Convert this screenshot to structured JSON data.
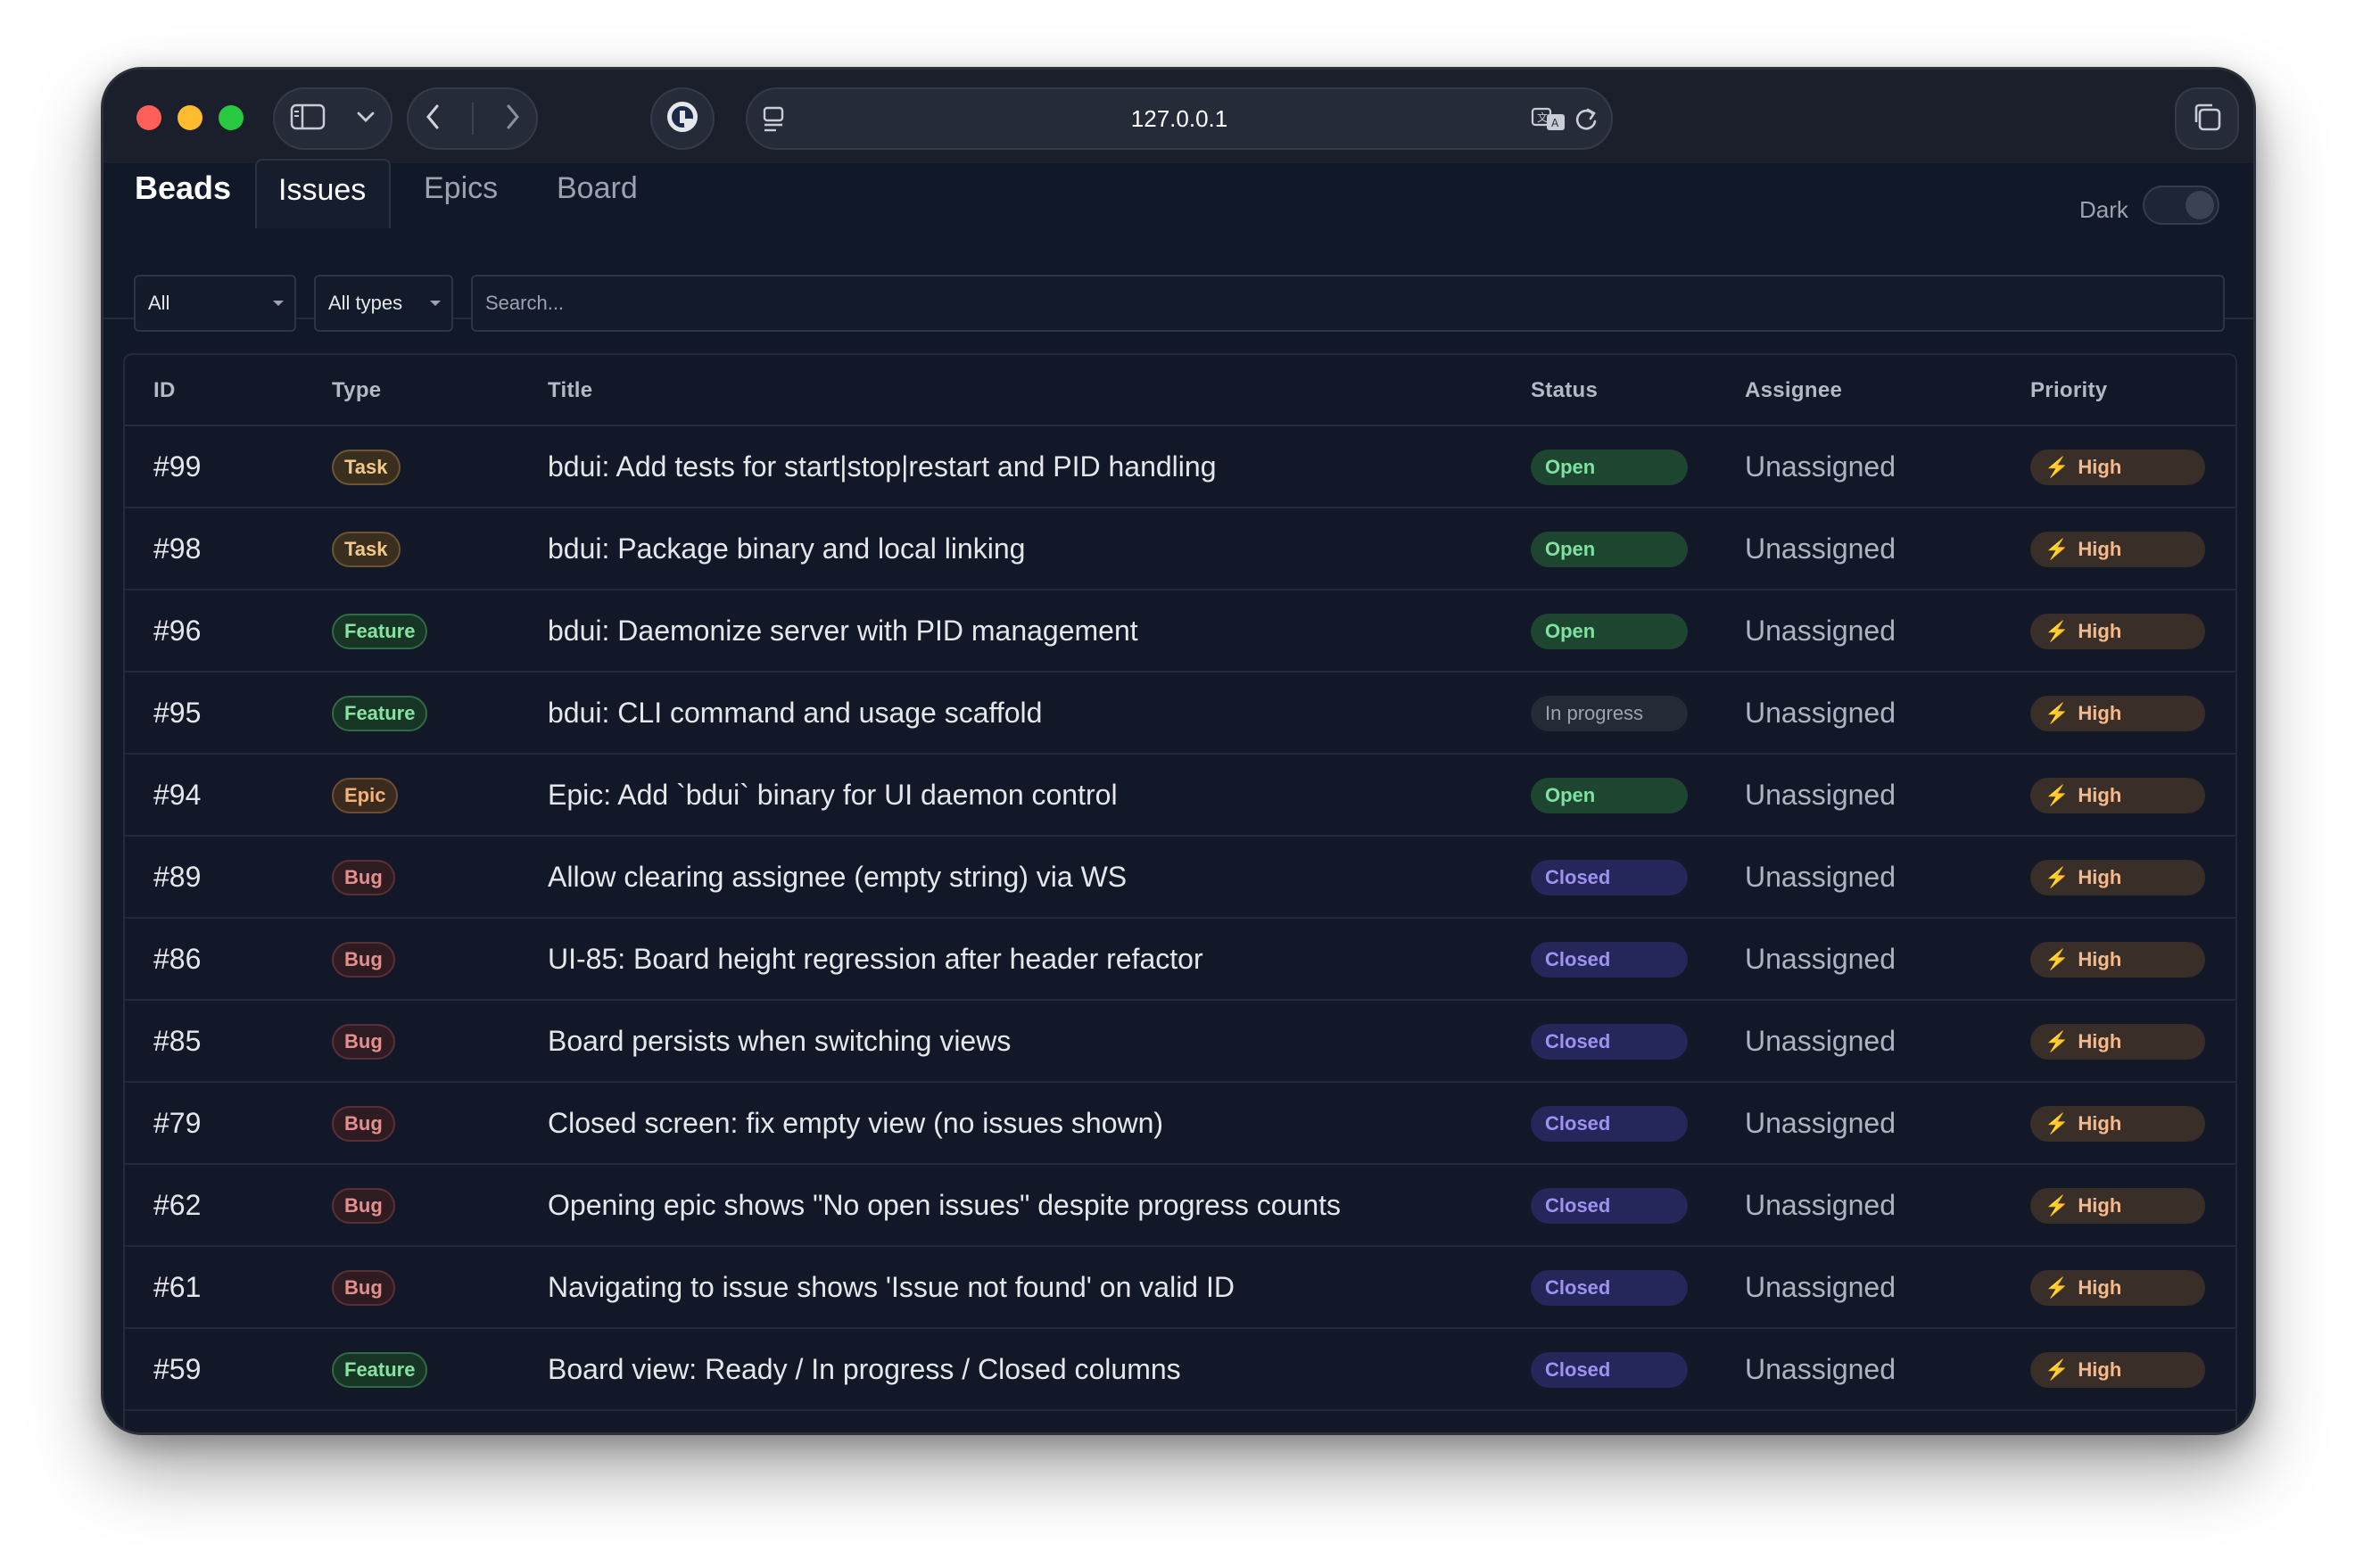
{
  "browser": {
    "address": "127.0.0.1"
  },
  "app": {
    "brand": "Beads",
    "tabs": [
      {
        "label": "Issues"
      },
      {
        "label": "Epics"
      },
      {
        "label": "Board"
      }
    ],
    "dark_label": "Dark"
  },
  "filters": {
    "status_value": "All",
    "type_value": "All types",
    "search_placeholder": "Search..."
  },
  "table": {
    "headers": {
      "id": "ID",
      "type": "Type",
      "title": "Title",
      "status": "Status",
      "assignee": "Assignee",
      "priority": "Priority"
    },
    "rows": [
      {
        "id": "#99",
        "type": "Task",
        "title": "bdui: Add tests for start|stop|restart and PID handling",
        "status": "Open",
        "assignee": "Unassigned",
        "priority": "High"
      },
      {
        "id": "#98",
        "type": "Task",
        "title": "bdui: Package binary and local linking",
        "status": "Open",
        "assignee": "Unassigned",
        "priority": "High"
      },
      {
        "id": "#96",
        "type": "Feature",
        "title": "bdui: Daemonize server with PID management",
        "status": "Open",
        "assignee": "Unassigned",
        "priority": "High"
      },
      {
        "id": "#95",
        "type": "Feature",
        "title": "bdui: CLI command and usage scaffold",
        "status": "In progress",
        "assignee": "Unassigned",
        "priority": "High"
      },
      {
        "id": "#94",
        "type": "Epic",
        "title": "Epic: Add `bdui` binary for UI daemon control",
        "status": "Open",
        "assignee": "Unassigned",
        "priority": "High"
      },
      {
        "id": "#89",
        "type": "Bug",
        "title": "Allow clearing assignee (empty string) via WS",
        "status": "Closed",
        "assignee": "Unassigned",
        "priority": "High"
      },
      {
        "id": "#86",
        "type": "Bug",
        "title": "UI-85: Board height regression after header refactor",
        "status": "Closed",
        "assignee": "Unassigned",
        "priority": "High"
      },
      {
        "id": "#85",
        "type": "Bug",
        "title": "Board persists when switching views",
        "status": "Closed",
        "assignee": "Unassigned",
        "priority": "High"
      },
      {
        "id": "#79",
        "type": "Bug",
        "title": "Closed screen: fix empty view (no issues shown)",
        "status": "Closed",
        "assignee": "Unassigned",
        "priority": "High"
      },
      {
        "id": "#62",
        "type": "Bug",
        "title": "Opening epic shows \"No open issues\" despite progress counts",
        "status": "Closed",
        "assignee": "Unassigned",
        "priority": "High"
      },
      {
        "id": "#61",
        "type": "Bug",
        "title": "Navigating to issue shows 'Issue not found' on valid ID",
        "status": "Closed",
        "assignee": "Unassigned",
        "priority": "High"
      },
      {
        "id": "#59",
        "type": "Feature",
        "title": "Board view: Ready / In progress / Closed columns",
        "status": "Closed",
        "assignee": "Unassigned",
        "priority": "High"
      }
    ]
  },
  "colors": {
    "open": "#7ee2a0",
    "closed": "#9d92f2",
    "priority_high": "#f6b98c"
  }
}
